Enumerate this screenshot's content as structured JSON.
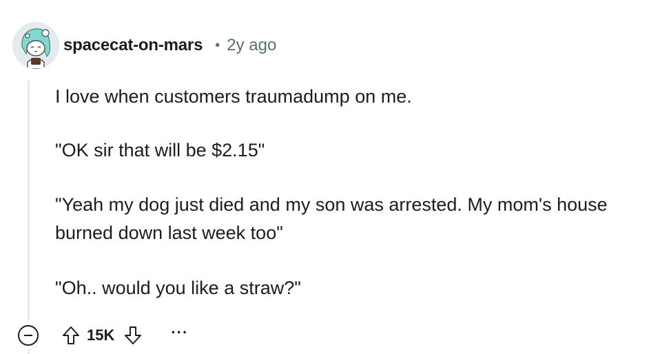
{
  "comment": {
    "author": "spacecat-on-mars",
    "separator": "•",
    "timestamp": "2y ago",
    "body": [
      "I love when customers traumadump on me.",
      "\"OK sir that will be $2.15\"",
      "\"Yeah my dog just died and my son was arrested. My mom's house burned down last week too\"",
      "\"Oh.. would you like a straw?\""
    ],
    "score": "15K",
    "more_label": "···"
  },
  "colors": {
    "text": "#1c1c1c",
    "meta": "#576f76",
    "thread_line": "#e5ebee",
    "avatar_bg": "#e6eaed",
    "avatar_hair": "#7fd9d0"
  },
  "icons": {
    "avatar": "avatar-snoo",
    "collapse": "minus-circle-icon",
    "upvote": "arrow-up-icon",
    "downvote": "arrow-down-icon",
    "more": "ellipsis-icon"
  }
}
